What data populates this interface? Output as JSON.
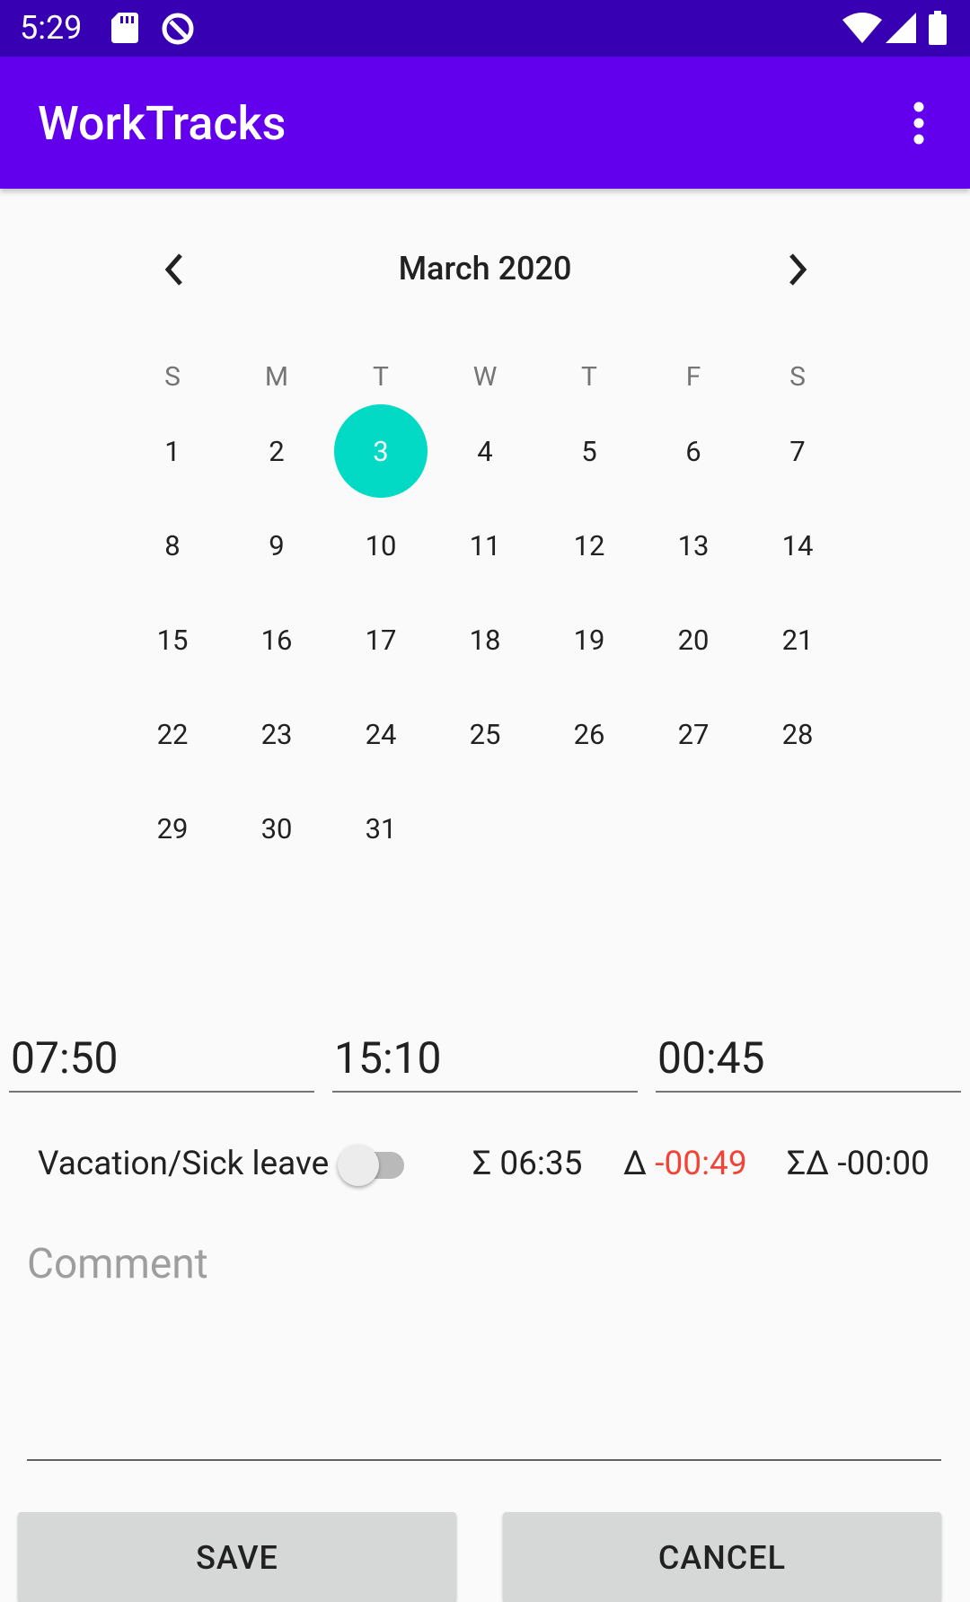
{
  "status_bar": {
    "time": "5:29"
  },
  "app_bar": {
    "title": "WorkTracks"
  },
  "calendar": {
    "month": "March 2020",
    "weekdays": [
      "S",
      "M",
      "T",
      "W",
      "T",
      "F",
      "S"
    ],
    "weeks": [
      [
        "1",
        "2",
        "3",
        "4",
        "5",
        "6",
        "7"
      ],
      [
        "8",
        "9",
        "10",
        "11",
        "12",
        "13",
        "14"
      ],
      [
        "15",
        "16",
        "17",
        "18",
        "19",
        "20",
        "21"
      ],
      [
        "22",
        "23",
        "24",
        "25",
        "26",
        "27",
        "28"
      ],
      [
        "29",
        "30",
        "31",
        "",
        "",
        "",
        ""
      ]
    ],
    "selected_day": "3"
  },
  "times": {
    "start": "07:50",
    "end": "15:10",
    "break": "00:45"
  },
  "summary": {
    "vacation_label": "Vacation/Sick leave",
    "vacation_on": false,
    "sum_symbol": "Σ",
    "sum": "06:35",
    "delta_symbol": "Δ",
    "delta": "-00:49",
    "total_delta_symbol": "ΣΔ",
    "total_delta": "-00:00",
    "negative_color": "#f44336"
  },
  "comment": {
    "placeholder": "Comment"
  },
  "buttons": {
    "save": "SAVE",
    "cancel": "CANCEL"
  }
}
